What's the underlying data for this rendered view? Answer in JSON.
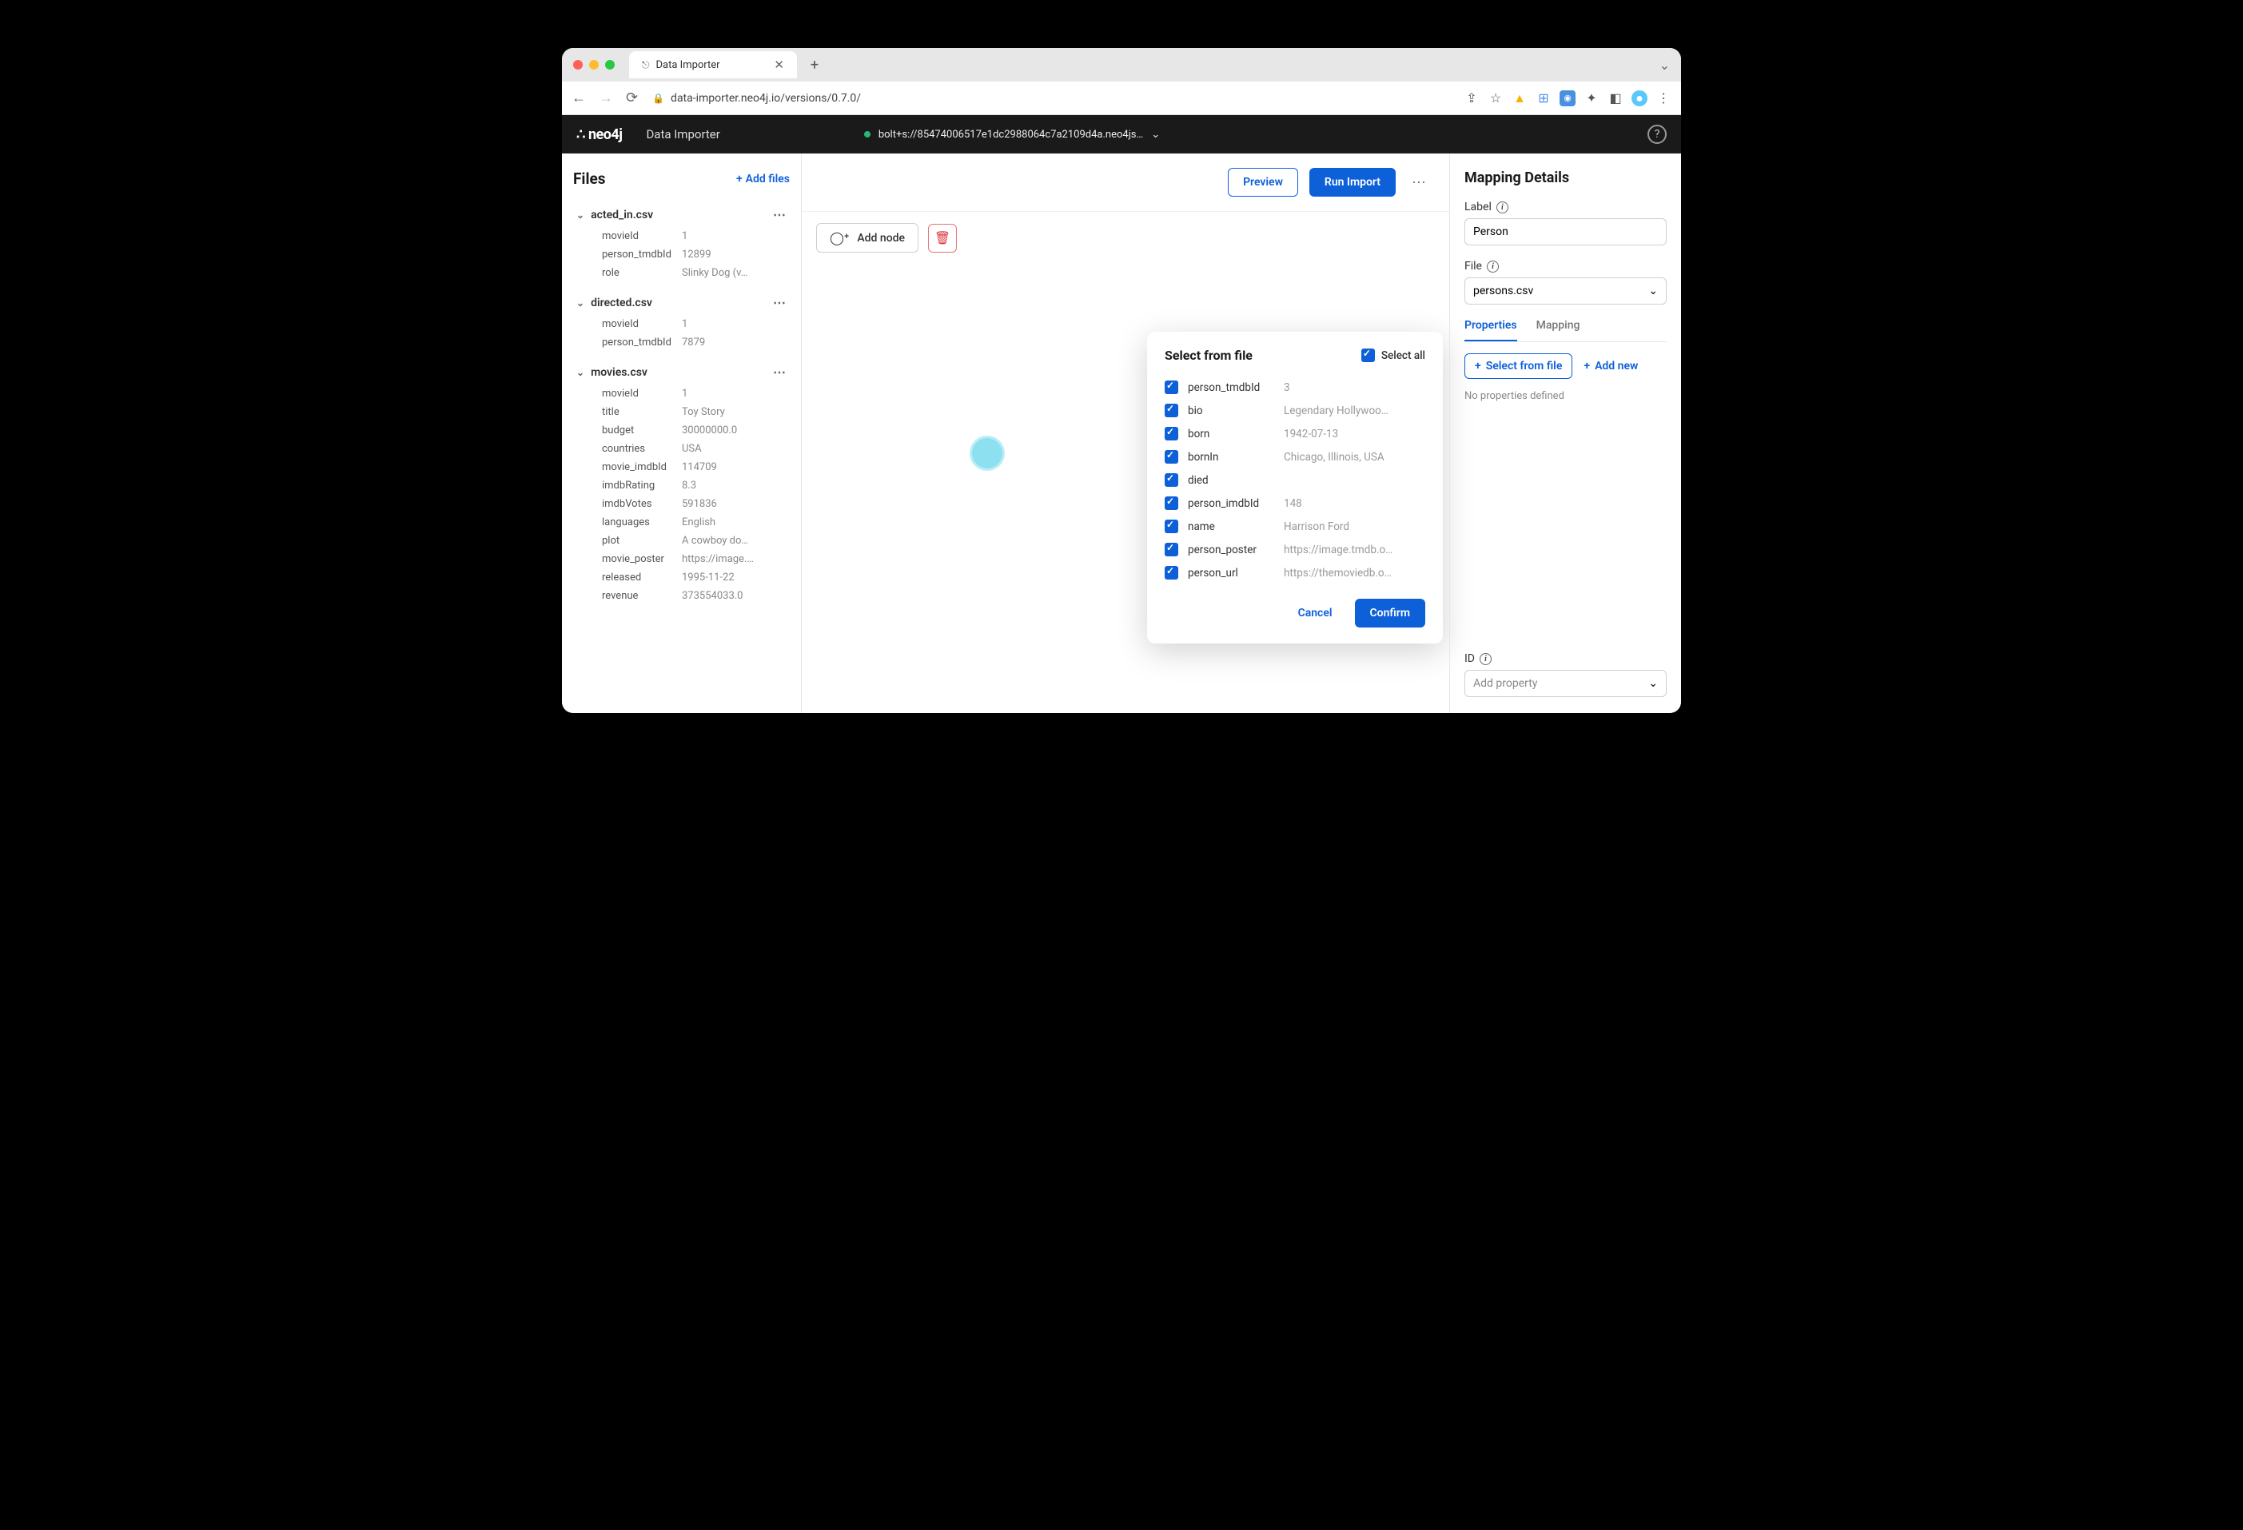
{
  "browser": {
    "tab_title": "Data Importer",
    "url": "data-importer.neo4j.io/versions/0.7.0/"
  },
  "header": {
    "logo": "neo4j",
    "title": "Data Importer",
    "connection": "bolt+s://85474006517e1dc2988064c7a2109d4a.neo4js…"
  },
  "sidebar": {
    "title": "Files",
    "add_files": "Add files",
    "files": [
      {
        "name": "acted_in.csv",
        "fields": [
          {
            "name": "movieId",
            "value": "1"
          },
          {
            "name": "person_tmdbId",
            "value": "12899"
          },
          {
            "name": "role",
            "value": "Slinky Dog (v…"
          }
        ]
      },
      {
        "name": "directed.csv",
        "fields": [
          {
            "name": "movieId",
            "value": "1"
          },
          {
            "name": "person_tmdbId",
            "value": "7879"
          }
        ]
      },
      {
        "name": "movies.csv",
        "fields": [
          {
            "name": "movieId",
            "value": "1"
          },
          {
            "name": "title",
            "value": "Toy Story"
          },
          {
            "name": "budget",
            "value": "30000000.0"
          },
          {
            "name": "countries",
            "value": "USA"
          },
          {
            "name": "movie_imdbId",
            "value": "114709"
          },
          {
            "name": "imdbRating",
            "value": "8.3"
          },
          {
            "name": "imdbVotes",
            "value": "591836"
          },
          {
            "name": "languages",
            "value": "English"
          },
          {
            "name": "plot",
            "value": "A cowboy do…"
          },
          {
            "name": "movie_poster",
            "value": "https://image.…"
          },
          {
            "name": "released",
            "value": "1995-11-22"
          },
          {
            "name": "revenue",
            "value": "373554033.0"
          }
        ]
      }
    ]
  },
  "canvas": {
    "preview": "Preview",
    "run_import": "Run Import",
    "add_node": "Add node"
  },
  "popup": {
    "title": "Select from file",
    "select_all": "Select all",
    "rows": [
      {
        "name": "person_tmdbId",
        "value": "3"
      },
      {
        "name": "bio",
        "value": "Legendary Hollywoo…"
      },
      {
        "name": "born",
        "value": "1942-07-13"
      },
      {
        "name": "bornIn",
        "value": "Chicago, Illinois, USA"
      },
      {
        "name": "died",
        "value": ""
      },
      {
        "name": "person_imdbId",
        "value": "148"
      },
      {
        "name": "name",
        "value": "Harrison Ford"
      },
      {
        "name": "person_poster",
        "value": "https://image.tmdb.o…"
      },
      {
        "name": "person_url",
        "value": "https://themoviedb.o…"
      }
    ],
    "cancel": "Cancel",
    "confirm": "Confirm"
  },
  "detail": {
    "title": "Mapping Details",
    "label_label": "Label",
    "label_value": "Person",
    "file_label": "File",
    "file_value": "persons.csv",
    "tab_properties": "Properties",
    "tab_mapping": "Mapping",
    "select_from_file": "Select from file",
    "add_new": "Add new",
    "empty": "No properties defined",
    "id_label": "ID",
    "id_placeholder": "Add property"
  }
}
